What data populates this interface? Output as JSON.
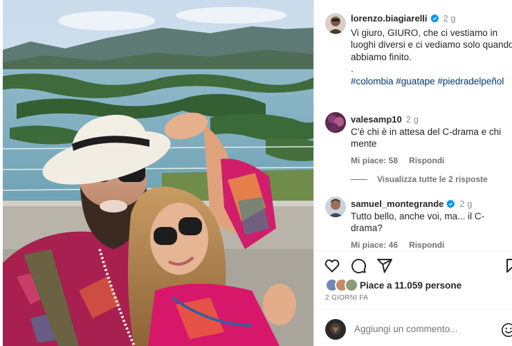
{
  "post": {
    "username": "lorenzo.biagiarelli",
    "verified": true,
    "age": "2 g",
    "caption": "Vi giuro, GIURO, che ci vestiamo in luoghi diversi e ci vediamo solo quando abbiamo finito.\n.",
    "hashtags": "#colombia #guatape #piedradelpeñol"
  },
  "comments": [
    {
      "username": "valesamp10",
      "age": "2 g",
      "text": "C'è chi è in attesa del C-drama e chi mente",
      "likes": "Mi piace: 58",
      "reply": "Rispondi"
    },
    {
      "username": "samuel_montegrande",
      "verified": true,
      "age": "2 g",
      "text": "Tutto bello, anche voi, ma... il C-drama?",
      "likes": "Mi piace: 46",
      "reply": "Rispondi"
    }
  ],
  "view_replies": "Visualizza tutte le 2 risposte",
  "likes_text": "Piace a 11.059 persone",
  "date": "2 GIORNI FA",
  "add_comment": {
    "placeholder": "Aggiungi un commento..."
  },
  "icons": {
    "like": "heart-icon",
    "comment": "comment-icon",
    "share": "send-icon",
    "save": "bookmark-icon",
    "emoji": "emoji-icon",
    "verified": "verified-badge-icon"
  },
  "colors": {
    "link": "#00376b",
    "verified": "#0095f6",
    "muted": "#737373"
  }
}
